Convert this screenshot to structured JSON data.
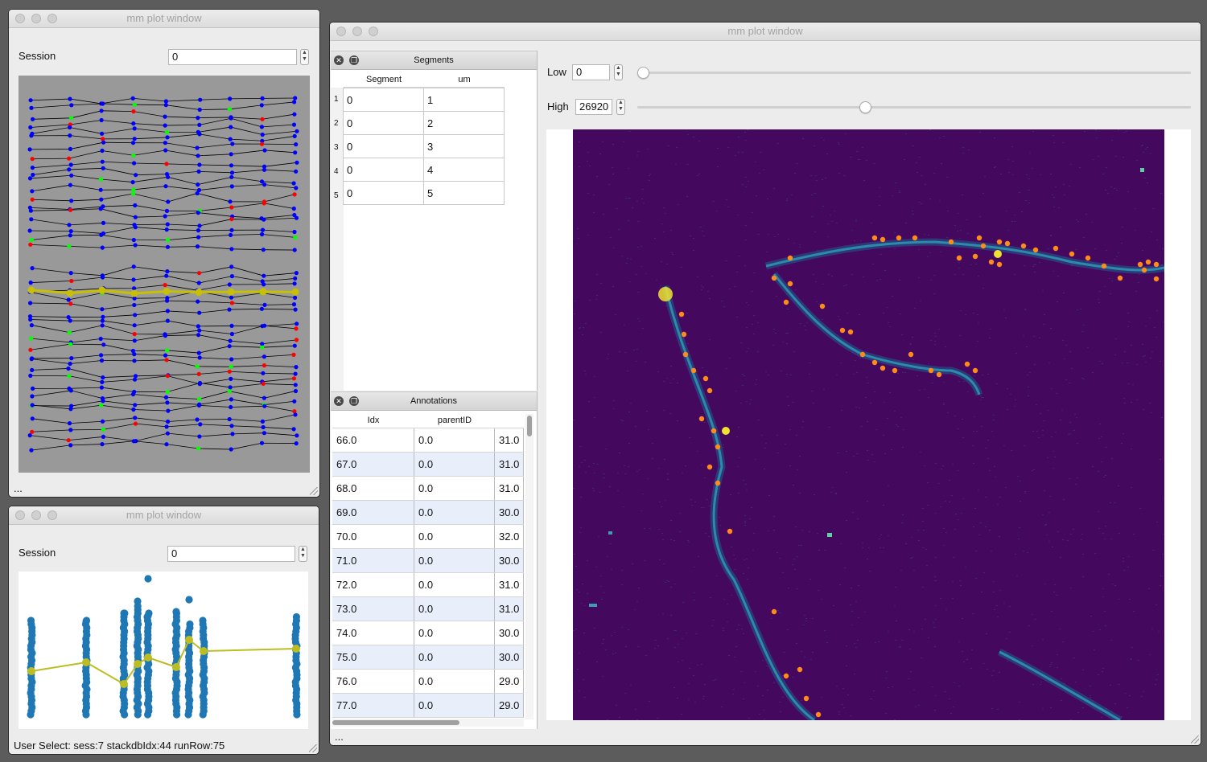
{
  "windows": {
    "win1": {
      "title": "mm plot window",
      "session_label": "Session",
      "session_value": "0",
      "status": "...",
      "plot_bg": "#999999",
      "colors": {
        "normal": "#0000ff",
        "red": "#ff0000",
        "green": "#00ff00",
        "selected": "#c8c000"
      }
    },
    "win2": {
      "title": "mm plot window",
      "session_label": "Session",
      "session_value": "0",
      "status": "User Select: sess:7 stackdbIdx:44 runRow:75",
      "colors": {
        "points": "#1f77b4",
        "line": "#bcbd22"
      }
    },
    "win3": {
      "title": "mm plot window",
      "status": "...",
      "low_label": "Low",
      "low_value": "0",
      "low_fraction": 0.0,
      "high_label": "High",
      "high_value": "26920",
      "high_fraction": 0.41,
      "image_colors": {
        "background": "#44085e",
        "dendrite": "#2a8ca8",
        "bright": "#f0e030",
        "annotation": "#ff8c1a"
      }
    }
  },
  "segments": {
    "title": "Segments",
    "columns": [
      "Segment",
      "um"
    ],
    "row_labels": [
      "1",
      "2",
      "3",
      "4",
      "5"
    ],
    "rows": [
      [
        "0",
        "1"
      ],
      [
        "0",
        "2"
      ],
      [
        "0",
        "3"
      ],
      [
        "0",
        "4"
      ],
      [
        "0",
        "5"
      ]
    ]
  },
  "annotations": {
    "title": "Annotations",
    "columns": [
      "Idx",
      "parentID",
      ""
    ],
    "rows": [
      [
        "66.0",
        "0.0",
        "31.0"
      ],
      [
        "67.0",
        "0.0",
        "31.0"
      ],
      [
        "68.0",
        "0.0",
        "31.0"
      ],
      [
        "69.0",
        "0.0",
        "30.0"
      ],
      [
        "70.0",
        "0.0",
        "32.0"
      ],
      [
        "71.0",
        "0.0",
        "30.0"
      ],
      [
        "72.0",
        "0.0",
        "31.0"
      ],
      [
        "73.0",
        "0.0",
        "31.0"
      ],
      [
        "74.0",
        "0.0",
        "30.0"
      ],
      [
        "75.0",
        "0.0",
        "30.0"
      ],
      [
        "76.0",
        "0.0",
        "29.0"
      ],
      [
        "77.0",
        "0.0",
        "29.0"
      ]
    ]
  }
}
